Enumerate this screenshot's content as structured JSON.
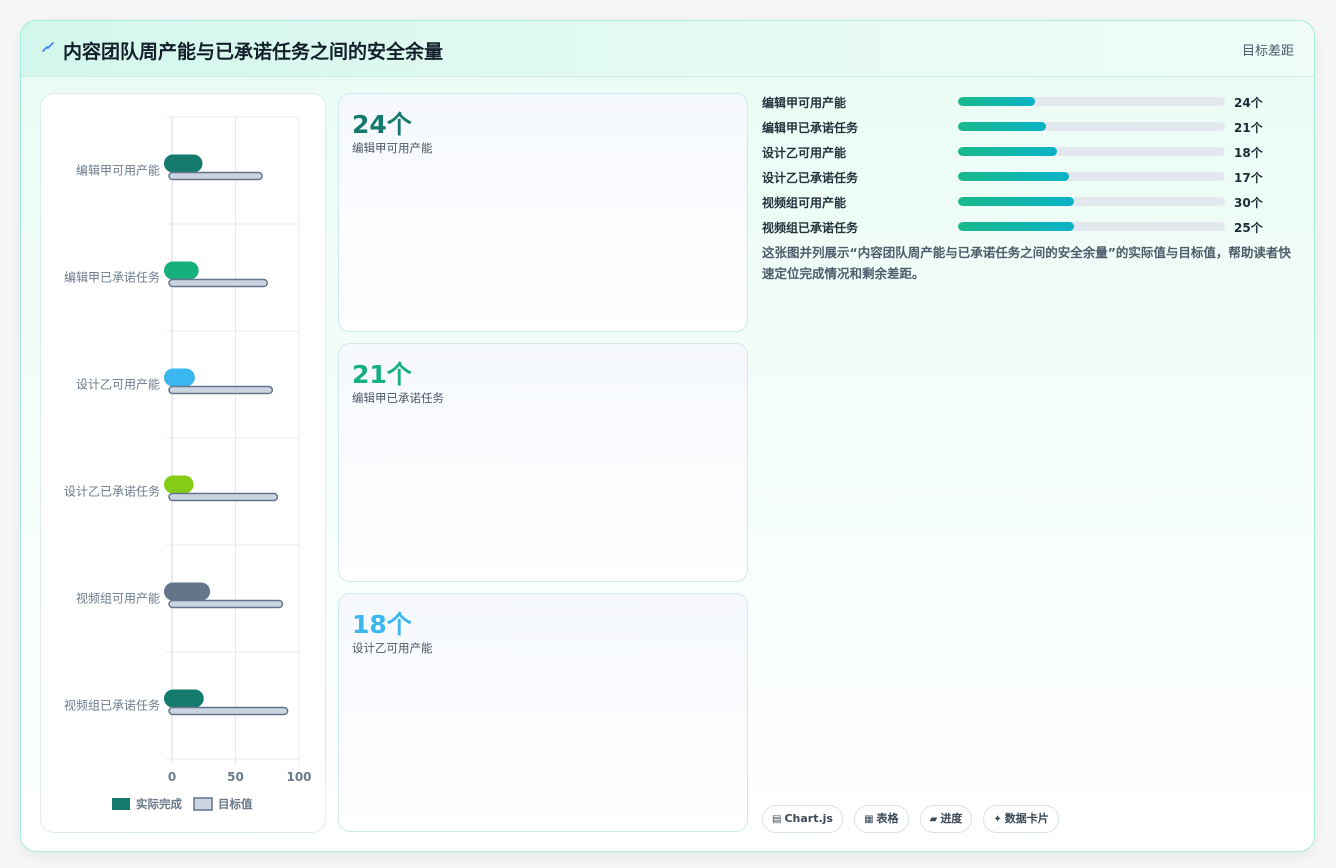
{
  "header": {
    "title": "内容团队周产能与已承诺任务之间的安全余量",
    "right_label": "目标差距",
    "icon": "lightning-icon"
  },
  "kpis": [
    {
      "value": "24个",
      "label": "编辑甲可用产能",
      "color": "#157a6e"
    },
    {
      "value": "21个",
      "label": "编辑甲已承诺任务",
      "color": "#16b07f"
    },
    {
      "value": "18个",
      "label": "设计乙可用产能",
      "color": "#3ab7ee"
    }
  ],
  "progress": [
    {
      "label": "编辑甲可用产能",
      "value": "24个",
      "fraction": 0.29
    },
    {
      "label": "编辑甲已承诺任务",
      "value": "21个",
      "fraction": 0.33
    },
    {
      "label": "设计乙可用产能",
      "value": "18个",
      "fraction": 0.37
    },
    {
      "label": "设计乙已承诺任务",
      "value": "17个",
      "fraction": 0.415
    },
    {
      "label": "视频组可用产能",
      "value": "30个",
      "fraction": 0.435
    },
    {
      "label": "视频组已承诺任务",
      "value": "25个",
      "fraction": 0.435
    }
  ],
  "description": "这张图并列展示“内容团队周产能与已承诺任务之间的安全余量”的实际值与目标值，帮助读者快速定位完成情况和剩余差距。",
  "chips": [
    {
      "icon": "▤",
      "icon_name": "chart-icon",
      "label": "Chart.js"
    },
    {
      "icon": "▦",
      "icon_name": "table-icon",
      "label": "表格"
    },
    {
      "icon": "▰",
      "icon_name": "progress-icon",
      "label": "进度"
    },
    {
      "icon": "✦",
      "icon_name": "sparkle-icon",
      "label": "数据卡片"
    }
  ],
  "chart_data": {
    "type": "bar",
    "orientation": "horizontal",
    "categories": [
      "编辑甲可用产能",
      "编辑甲已承诺任务",
      "设计乙可用产能",
      "设计乙已承诺任务",
      "视频组可用产能",
      "视频组已承诺任务"
    ],
    "series": [
      {
        "name": "实际完成",
        "values": [
          24,
          21,
          18,
          17,
          30,
          25
        ],
        "colors": [
          "#157a6e",
          "#16b07f",
          "#3ab7ee",
          "#84cc16",
          "#64748b",
          "#157a6e"
        ]
      },
      {
        "name": "目标值",
        "values": [
          71,
          75,
          79,
          83,
          87,
          91
        ],
        "color": "#cbd5e1",
        "border": "#64748b"
      }
    ],
    "x_ticks": [
      0,
      50,
      100
    ],
    "xlim": [
      0,
      100
    ],
    "grid": true,
    "legend": "bottom"
  }
}
